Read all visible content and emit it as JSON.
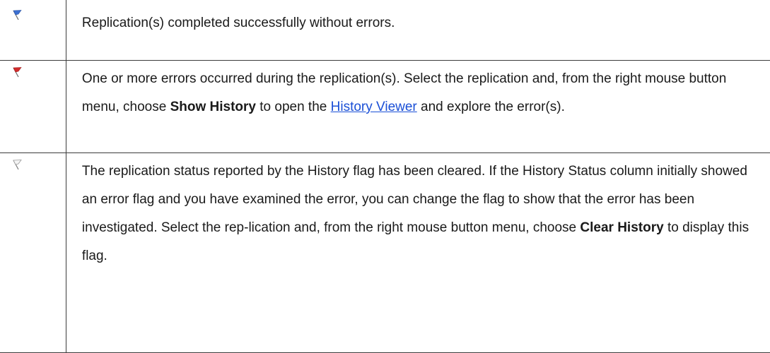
{
  "rows": [
    {
      "icon": "blue-flag-icon",
      "text": "Replication(s) completed successfully without errors."
    },
    {
      "icon": "red-flag-icon",
      "text_pre": "One or more errors occurred during the replication(s). Select the replication and, from the right mouse button menu, choose ",
      "bold": "Show History",
      "text_mid": " to open the ",
      "link": "History Viewer",
      "text_post": " and explore the error(s)."
    },
    {
      "icon": "white-flag-icon",
      "text_pre": "The replication status reported by the History flag has been cleared. If the History Status column initially showed an error flag and you have examined the error, you can change the flag to show that the error has been investigated. Select the rep-lication and, from the right mouse button menu, choose ",
      "bold": "Clear History",
      "text_post": " to display this flag."
    }
  ],
  "colors": {
    "link": "#1a4fd6",
    "blue_flag": "#3b6fd1",
    "red_flag": "#d12b2b",
    "white_flag": "#f4f4f4",
    "border": "#3c3c3c"
  }
}
